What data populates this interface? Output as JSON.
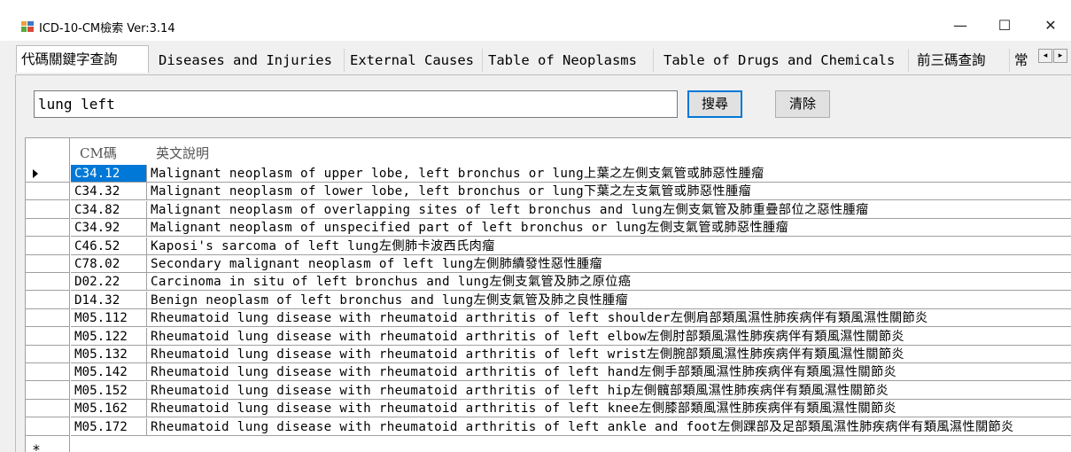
{
  "window": {
    "title": "ICD-10-CM檢索  Ver:3.14",
    "minimize": "—",
    "maximize": "☐",
    "close": "✕",
    "icon": "app-icon"
  },
  "tabs": [
    {
      "label": "代碼關鍵字查詢",
      "active": true
    },
    {
      "label": "Diseases and Injuries"
    },
    {
      "label": "External Causes"
    },
    {
      "label": "Table of Neoplasms"
    },
    {
      "label": "Table of Drugs and Chemicals"
    },
    {
      "label": "前三碼查詢"
    },
    {
      "label": "常"
    }
  ],
  "tab_scroll": {
    "left": "◂",
    "right": "▸"
  },
  "search": {
    "value": "lung left"
  },
  "buttons": {
    "search": "搜尋",
    "clear": "清除"
  },
  "grid": {
    "columns": [
      "CM碼",
      "英文說明"
    ],
    "selected_index": 0,
    "new_row_marker": "*",
    "rows": [
      {
        "code": "C34.12",
        "desc": "Malignant neoplasm of upper lobe, left bronchus or lung上葉之左側支氣管或肺惡性腫瘤"
      },
      {
        "code": "C34.32",
        "desc": "Malignant neoplasm of lower lobe, left bronchus or lung下葉之左支氣管或肺惡性腫瘤"
      },
      {
        "code": "C34.82",
        "desc": "Malignant neoplasm of overlapping sites of left bronchus and lung左側支氣管及肺重疊部位之惡性腫瘤"
      },
      {
        "code": "C34.92",
        "desc": "Malignant neoplasm of unspecified part of left bronchus or lung左側支氣管或肺惡性腫瘤"
      },
      {
        "code": "C46.52",
        "desc": "Kaposi's sarcoma of left lung左側肺卡波西氏肉瘤"
      },
      {
        "code": "C78.02",
        "desc": "Secondary malignant neoplasm of left lung左側肺續發性惡性腫瘤"
      },
      {
        "code": "D02.22",
        "desc": "Carcinoma in situ of left bronchus and lung左側支氣管及肺之原位癌"
      },
      {
        "code": "D14.32",
        "desc": "Benign neoplasm of left bronchus and lung左側支氣管及肺之良性腫瘤"
      },
      {
        "code": "M05.112",
        "desc": "Rheumatoid lung disease with rheumatoid arthritis of left shoulder左側肩部類風濕性肺疾病伴有類風濕性關節炎"
      },
      {
        "code": "M05.122",
        "desc": "Rheumatoid lung disease with rheumatoid arthritis of left elbow左側肘部類風濕性肺疾病伴有類風濕性關節炎"
      },
      {
        "code": "M05.132",
        "desc": "Rheumatoid lung disease with rheumatoid arthritis of left wrist左側腕部類風濕性肺疾病伴有類風濕性關節炎"
      },
      {
        "code": "M05.142",
        "desc": "Rheumatoid lung disease with rheumatoid arthritis of left hand左側手部類風濕性肺疾病伴有類風濕性關節炎"
      },
      {
        "code": "M05.152",
        "desc": "Rheumatoid lung disease with rheumatoid arthritis of left hip左側髖部類風濕性肺疾病伴有類風濕性關節炎"
      },
      {
        "code": "M05.162",
        "desc": "Rheumatoid lung disease with rheumatoid arthritis of left knee左側膝部類風濕性肺疾病伴有類風濕性關節炎"
      },
      {
        "code": "M05.172",
        "desc": "Rheumatoid lung disease with rheumatoid arthritis of left ankle and foot左側踝部及足部類風濕性肺疾病伴有類風濕性關節炎"
      }
    ]
  },
  "colors": {
    "selection": "#0078d7",
    "accent_border": "#0078d7"
  }
}
